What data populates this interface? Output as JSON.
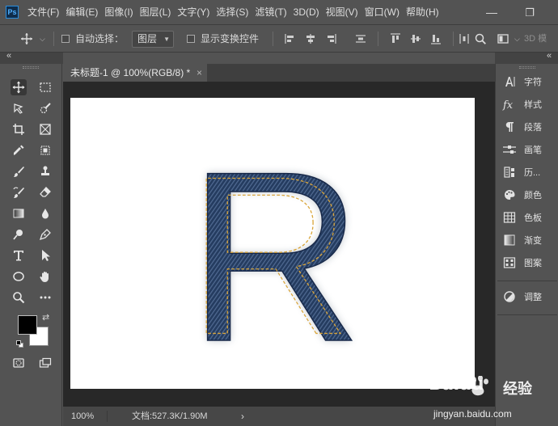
{
  "app": {
    "logo": "Ps"
  },
  "menubar": {
    "items": [
      "文件(F)",
      "编辑(E)",
      "图像(I)",
      "图层(L)",
      "文字(Y)",
      "选择(S)",
      "滤镜(T)",
      "3D(D)",
      "视图(V)",
      "窗口(W)",
      "帮助(H)"
    ],
    "minimize": "—",
    "restore": "❐"
  },
  "options": {
    "auto_select_label": "自动选择：",
    "auto_select_target": "图层",
    "show_transform_label": "显示变换控件",
    "mode_3d": "3D 模"
  },
  "collapse": {
    "left": "«",
    "right": "«"
  },
  "document": {
    "tab_title": "未标题-1 @ 100%(RGB/8) *",
    "close": "×",
    "letter": "R"
  },
  "status": {
    "zoom": "100%",
    "doc_info": "文档:527.3K/1.90M",
    "arrow": "›"
  },
  "right_panel": {
    "items": [
      {
        "icon": "type-icon",
        "label": "字符"
      },
      {
        "icon": "fx-icon",
        "label": "样式"
      },
      {
        "icon": "pilcrow-icon",
        "label": "段落"
      },
      {
        "icon": "brush-settings-icon",
        "label": "画笔"
      },
      {
        "icon": "history-icon",
        "label": "历..."
      },
      {
        "icon": "palette-icon",
        "label": "颜色"
      },
      {
        "icon": "swatches-icon",
        "label": "色板"
      },
      {
        "icon": "gradient-icon",
        "label": "渐变"
      },
      {
        "icon": "pattern-icon",
        "label": "图案"
      },
      {
        "icon": "adjustments-icon",
        "label": "调整"
      }
    ]
  },
  "watermark": {
    "brand": "Baidu",
    "brand_cn": "经验",
    "url": "jingyan.baidu.com"
  },
  "colors": {
    "bg_panel": "#535353",
    "canvas_bg": "#282828",
    "denim_dark": "#1f3556",
    "denim_light": "#4a648c",
    "stitch": "#d9a53a",
    "foreground": "#000000",
    "background": "#ffffff"
  }
}
